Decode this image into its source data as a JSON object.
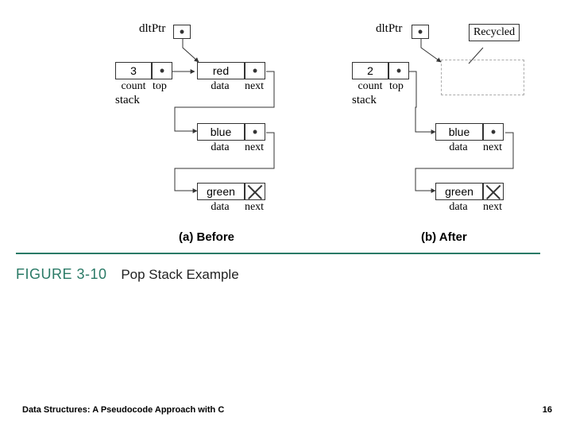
{
  "diagram": {
    "ptr_label": "dltPtr",
    "stack_label": "stack",
    "fields": {
      "count": "count",
      "top": "top",
      "data": "data",
      "next": "next"
    },
    "before": {
      "count": "3",
      "nodes": [
        {
          "data": "red",
          "next_null": false
        },
        {
          "data": "blue",
          "next_null": false
        },
        {
          "data": "green",
          "next_null": true
        }
      ],
      "caption": "(a) Before"
    },
    "after": {
      "count": "2",
      "nodes": [
        {
          "data": "blue",
          "next_null": false
        },
        {
          "data": "green",
          "next_null": true
        }
      ],
      "caption": "(b) After",
      "recycled_label": "Recycled"
    }
  },
  "figure": {
    "number": "FIGURE 3-10",
    "title": "Pop Stack Example"
  },
  "footer": {
    "text": "Data Structures: A Pseudocode Approach with C",
    "page": "16"
  }
}
